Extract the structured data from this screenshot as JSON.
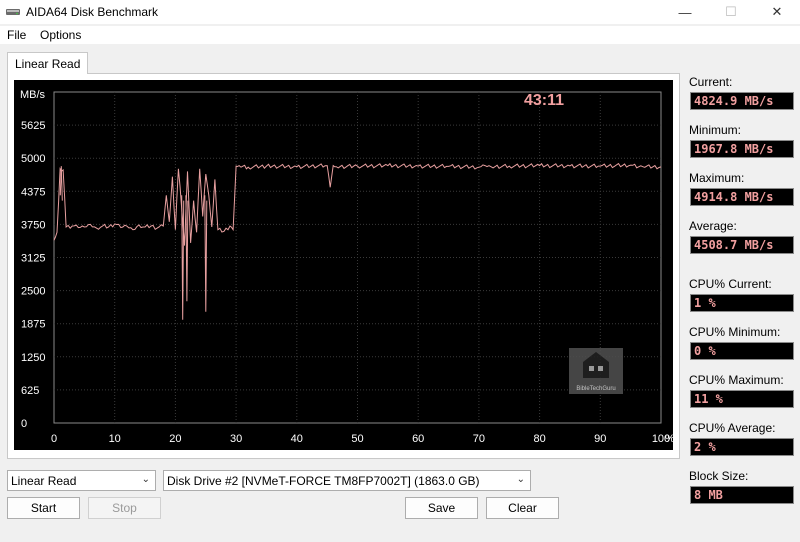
{
  "window": {
    "title": "AIDA64 Disk Benchmark"
  },
  "menu": {
    "file": "File",
    "options": "Options"
  },
  "tab": {
    "label": "Linear Read"
  },
  "chart_data": {
    "type": "line",
    "y_unit": "MB/s",
    "x_unit": "%",
    "timer": "43:11",
    "y_ticks": [
      "5625",
      "5000",
      "4375",
      "3750",
      "3125",
      "2500",
      "1875",
      "1250",
      "625",
      "0"
    ],
    "y_values": [
      5625,
      5000,
      4375,
      3750,
      3125,
      2500,
      1875,
      1250,
      625,
      0
    ],
    "x_ticks": [
      "0",
      "10",
      "20",
      "30",
      "40",
      "50",
      "60",
      "70",
      "80",
      "90",
      "100"
    ],
    "x_values": [
      0,
      10,
      20,
      30,
      40,
      50,
      60,
      70,
      80,
      90,
      100
    ],
    "xlim": [
      0,
      100
    ],
    "ylim": [
      0,
      6250
    ],
    "grid": true,
    "line_color": "#e8a0a0",
    "series": [
      {
        "x": [
          0,
          0.5,
          1,
          1.5,
          2,
          3,
          4,
          5,
          6,
          7,
          8,
          9,
          10,
          11,
          12,
          13,
          14,
          15,
          16,
          17,
          18,
          18.5,
          19,
          19.5,
          20,
          20.5,
          21,
          21.5,
          22,
          22.5,
          23,
          23.5,
          24,
          24.5,
          25,
          25.5,
          26,
          26.5,
          27,
          28,
          29,
          29.5,
          30,
          30.5,
          32,
          35,
          40,
          45,
          45.5,
          46,
          46.5,
          50,
          55,
          60,
          65,
          70,
          71,
          72,
          75,
          80,
          85,
          90,
          95,
          97,
          100
        ],
        "y": [
          3450,
          3600,
          4800,
          4780,
          3700,
          3720,
          3690,
          3700,
          3750,
          3680,
          3720,
          3700,
          3760,
          3690,
          3720,
          3650,
          3740,
          3700,
          3720,
          3680,
          3720,
          4300,
          3800,
          4650,
          3650,
          4800,
          4100,
          3350,
          4750,
          3400,
          4200,
          3600,
          4800,
          3900,
          4700,
          4300,
          3700,
          4600,
          3650,
          3620,
          3720,
          3650,
          4850,
          4860,
          4830,
          4850,
          4840,
          4860,
          4450,
          4860,
          4840,
          4850,
          4860,
          4850,
          4845,
          4830,
          4860,
          4840,
          4850,
          4860,
          4855,
          4850,
          4870,
          4840,
          4835
        ],
        "spikes": [
          {
            "x": 21.2,
            "y": 1950
          },
          {
            "x": 21.9,
            "y": 2300
          },
          {
            "x": 25.0,
            "y": 2100
          },
          {
            "x": 1.2,
            "y": 4850
          }
        ]
      }
    ]
  },
  "stats": {
    "current_label": "Current:",
    "current_value": "4824.9 MB/s",
    "minimum_label": "Minimum:",
    "minimum_value": "1967.8 MB/s",
    "maximum_label": "Maximum:",
    "maximum_value": "4914.8 MB/s",
    "average_label": "Average:",
    "average_value": "4508.7 MB/s",
    "cpu_current_label": "CPU% Current:",
    "cpu_current_value": "1 %",
    "cpu_minimum_label": "CPU% Minimum:",
    "cpu_minimum_value": "0 %",
    "cpu_maximum_label": "CPU% Maximum:",
    "cpu_maximum_value": "11 %",
    "cpu_average_label": "CPU% Average:",
    "cpu_average_value": "2 %",
    "block_size_label": "Block Size:",
    "block_size_value": "8 MB"
  },
  "controls": {
    "test_select": "Linear Read",
    "drive_select": "Disk Drive #2  [NVMeT-FORCE TM8FP7002T]  (1863.0 GB)",
    "start": "Start",
    "stop": "Stop",
    "save": "Save",
    "clear": "Clear"
  },
  "watermark": {
    "text": "BibleTechGuru"
  },
  "colors": {
    "stat_text": "#f2a0a0",
    "chart_bg": "#000000",
    "grid": "#3a3a3a",
    "axis_text": "#ffffff",
    "timer": "#f2a0a0"
  }
}
